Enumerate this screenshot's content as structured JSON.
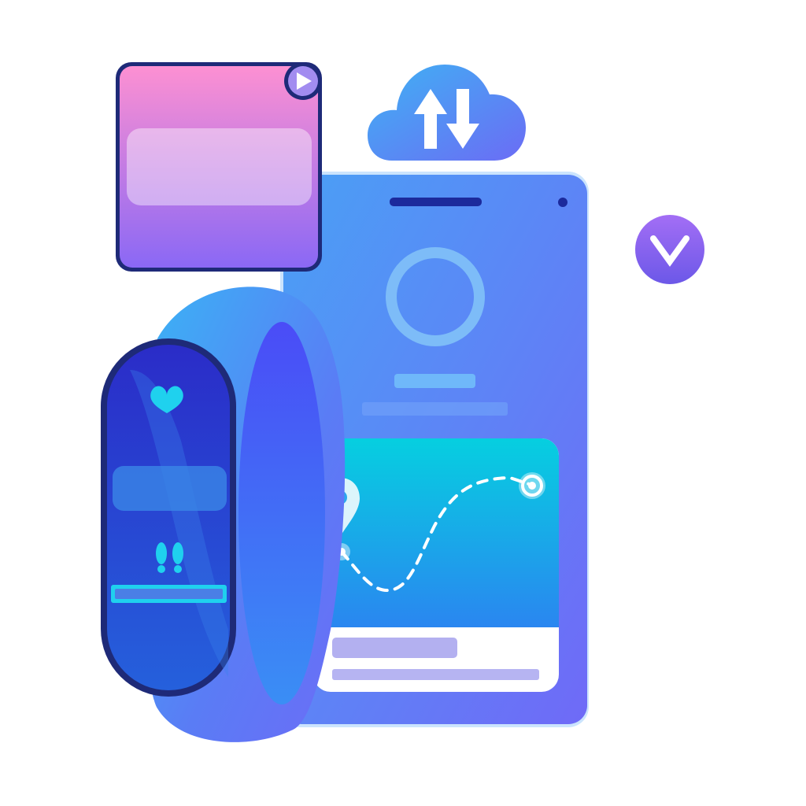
{
  "illustration": {
    "elements": {
      "video_card": {
        "icon": "play-icon"
      },
      "cloud": {
        "icon": "sync-arrows-icon"
      },
      "badge": {
        "icon": "chevron-down-icon"
      },
      "phone": {
        "avatar": "circle-placeholder",
        "map_card": {
          "start_icon": "location-pin-icon",
          "end_icon": "target-dot-icon",
          "route": "dashed-curve"
        }
      },
      "fitness_band": {
        "icons": [
          "heart-icon",
          "footsteps-icon"
        ],
        "progress": 1.0
      }
    },
    "colors": {
      "phone_top": "#4a9af4",
      "phone_bottom": "#6f6cf7",
      "band_dark": "#2a2cc4",
      "accent_cyan": "#1fd1ee",
      "pink": "#fb8fd3",
      "purple": "#8a68f5",
      "outline": "#1e2a78",
      "white": "#ffffff"
    }
  }
}
